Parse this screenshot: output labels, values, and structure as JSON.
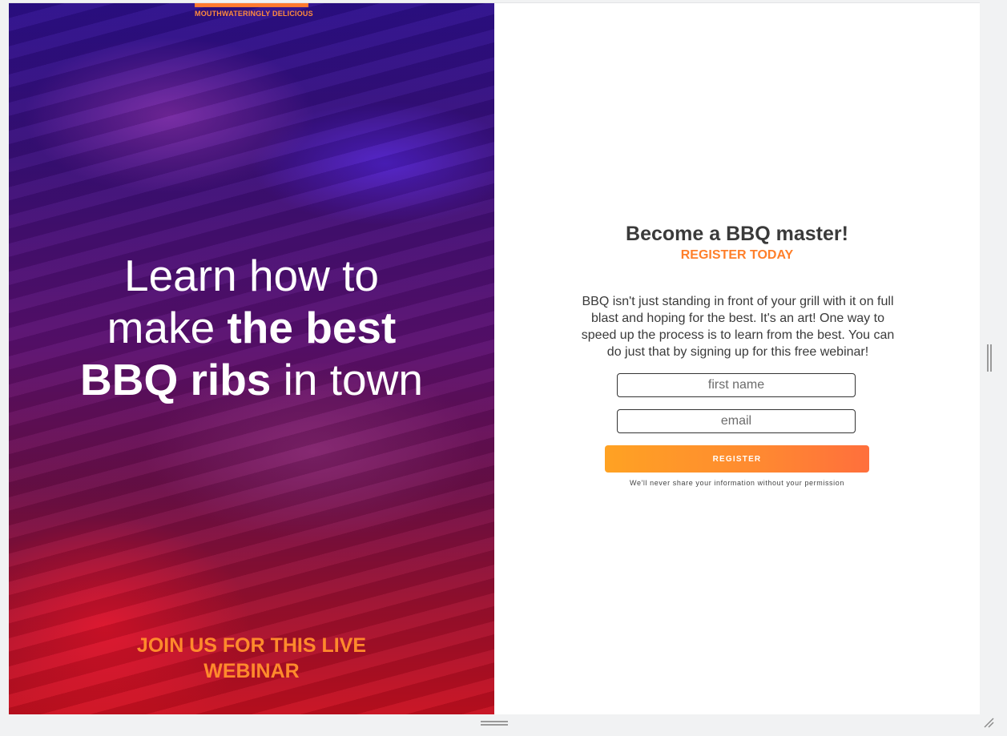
{
  "hero": {
    "brand_tag": "MOUTHWATERINGLY DELICIOUS",
    "headline": {
      "line1": "Learn how to",
      "line2_prefix": "make ",
      "line2_bold": "the best",
      "line3_bold": "BBQ ribs",
      "line3_suffix": " in town"
    },
    "cta": {
      "line1": "JOIN US FOR THIS LIVE",
      "line2": "WEBINAR"
    }
  },
  "form": {
    "title": "Become a BBQ master!",
    "subtitle": "REGISTER TODAY",
    "description": "BBQ isn't just standing in front of your grill with it on full blast and hoping for the best. It's an art! One way to speed up the process is to learn from the best. You can do just that by signing up for this free webinar!",
    "first_name_placeholder": "first name",
    "email_placeholder": "email",
    "register_label": "REGISTER",
    "privacy_note": "We'll never share your information without your permission"
  },
  "colors": {
    "accent_orange": "#ff7f2a",
    "button_gradient_start": "#ffa223",
    "button_gradient_end": "#ff6f3c",
    "text_dark": "#3a3a3a"
  },
  "icons": {
    "vertical_scroll": "resize-handle-vertical-icon",
    "horizontal_scroll": "resize-handle-horizontal-icon",
    "corner": "resize-corner-icon"
  }
}
